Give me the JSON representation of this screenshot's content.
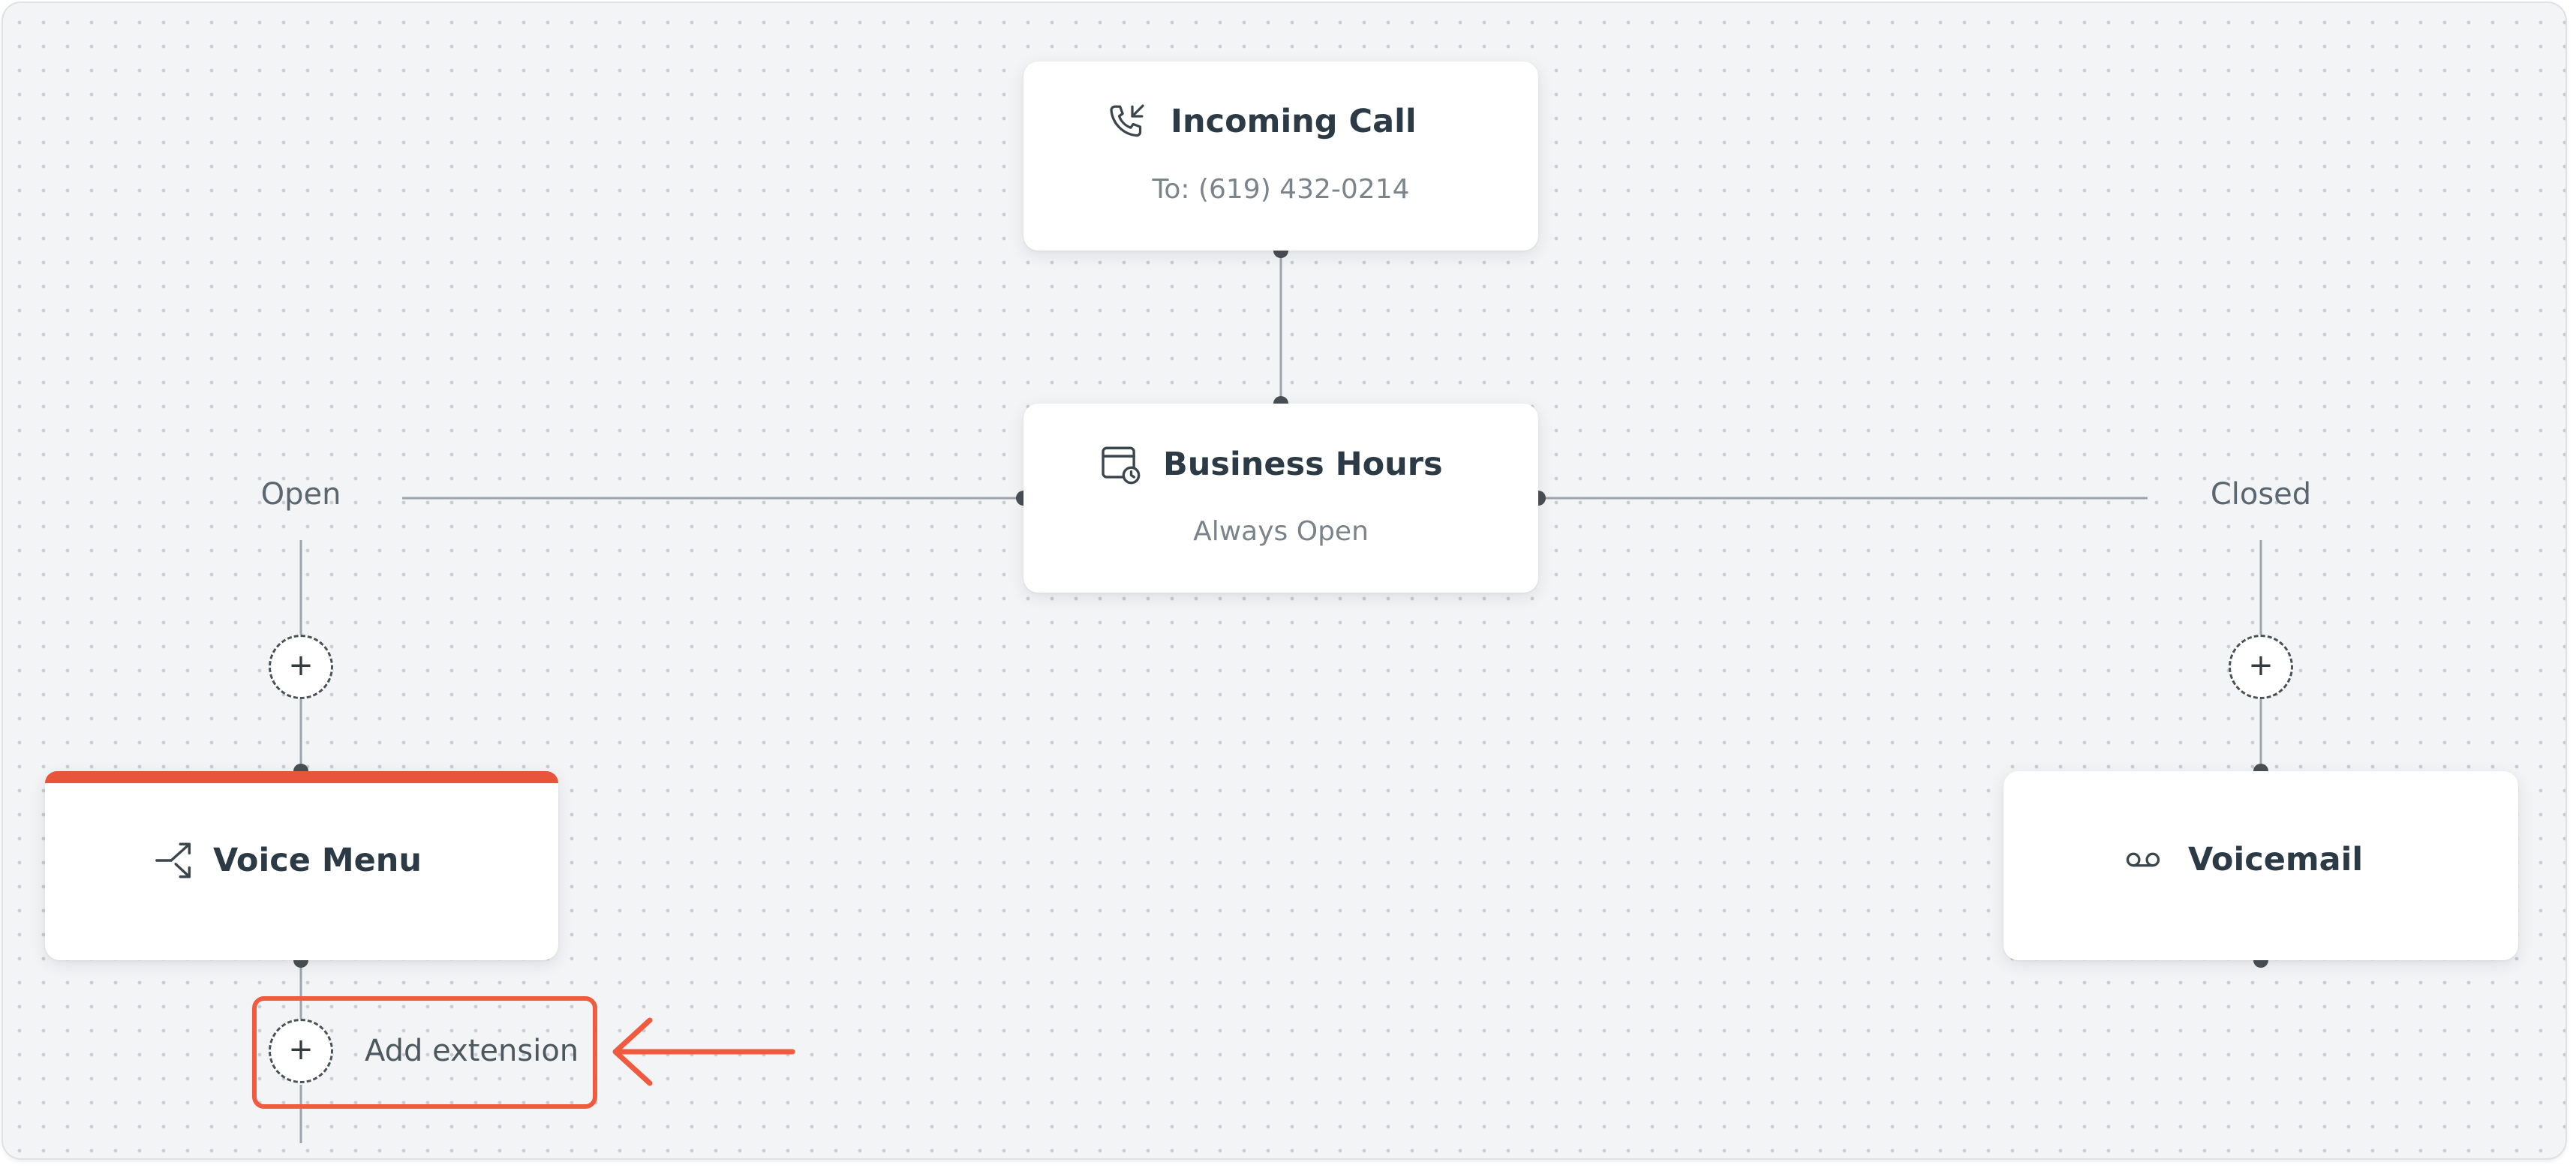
{
  "nodes": {
    "incoming_call": {
      "title": "Incoming Call",
      "subtitle": "To: (619) 432-0214",
      "icon": "phone-incoming-icon"
    },
    "business_hours": {
      "title": "Business Hours",
      "subtitle": "Always Open",
      "icon": "calendar-clock-icon"
    },
    "voice_menu": {
      "title": "Voice Menu",
      "icon": "split-route-icon",
      "accent": "#e8553a"
    },
    "voicemail": {
      "title": "Voicemail",
      "icon": "voicemail-icon"
    }
  },
  "branches": {
    "open_label": "Open",
    "closed_label": "Closed"
  },
  "actions": {
    "add_symbol": "+",
    "add_extension_label": "Add extension"
  },
  "colors": {
    "canvas": "#f3f4f6",
    "text_primary": "#2b3a44",
    "text_secondary": "#7b848b",
    "highlight": "#f05a3e",
    "connector": "#9ea4a9"
  }
}
